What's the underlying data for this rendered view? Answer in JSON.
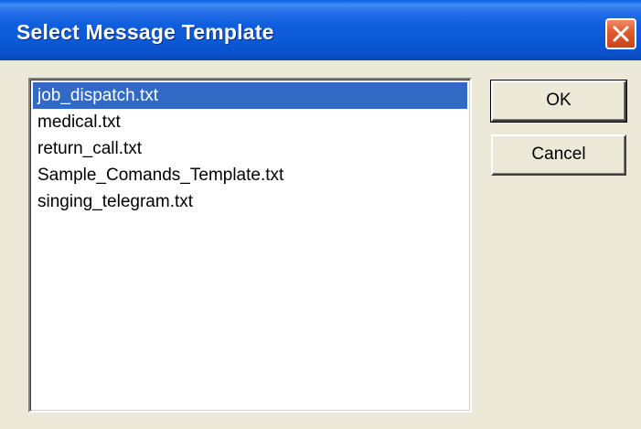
{
  "window": {
    "title": "Select Message Template"
  },
  "title_bar": {
    "close_icon": "close-x-icon"
  },
  "template_list": {
    "items": [
      {
        "label": "job_dispatch.txt",
        "selected": true
      },
      {
        "label": "medical.txt",
        "selected": false
      },
      {
        "label": "return_call.txt",
        "selected": false
      },
      {
        "label": "Sample_Comands_Template.txt",
        "selected": false
      },
      {
        "label": "singing_telegram.txt",
        "selected": false
      }
    ]
  },
  "buttons": {
    "ok_label": "OK",
    "cancel_label": "Cancel"
  },
  "colors": {
    "title_bar": "#0b58d6",
    "selection": "#316ac5",
    "dialog_face": "#ece9d8",
    "close_button": "#e0592e"
  }
}
